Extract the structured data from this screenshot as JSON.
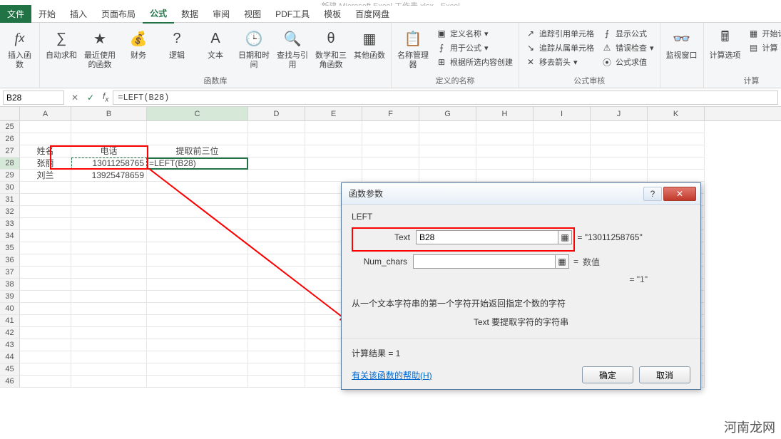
{
  "title": "新建 Microsoft Excel 工作表.xlsx - Excel",
  "tabs": {
    "file": "文件",
    "home": "开始",
    "insert": "插入",
    "layout": "页面布局",
    "formulas": "公式",
    "data": "数据",
    "review": "审阅",
    "view": "视图",
    "pdf": "PDF工具",
    "template": "模板",
    "baidu": "百度网盘"
  },
  "ribbon": {
    "g1_label": "",
    "insertFn": "插入函数",
    "autosum": "自动求和",
    "recent": "最近使用的函数",
    "financial": "财务",
    "logical": "逻辑",
    "text": "文本",
    "datetime": "日期和时间",
    "lookup": "查找与引用",
    "math": "数学和三角函数",
    "more": "其他函数",
    "glib": "函数库",
    "nameMgr": "名称管理器",
    "defName": "定义名称",
    "useFormula": "用于公式",
    "createFromSel": "根据所选内容创建",
    "gnames": "定义的名称",
    "tracePrec": "追踪引用单元格",
    "traceDep": "追踪从属单元格",
    "removeArr": "移去箭头",
    "showFormulas": "显示公式",
    "errCheck": "错误检查",
    "evalFormula": "公式求值",
    "gaudit": "公式审核",
    "watch": "监视窗口",
    "calcOpt": "计算选项",
    "calcNow": "开始计算",
    "calcSheet": "计算",
    "gcalc": "计算"
  },
  "namebox": "B28",
  "formula": "=LEFT(B28)",
  "columns": [
    "A",
    "B",
    "C",
    "D",
    "E",
    "F",
    "G",
    "H",
    "I",
    "J",
    "K"
  ],
  "rows": [
    "25",
    "26",
    "27",
    "28",
    "29",
    "30",
    "31",
    "32",
    "33",
    "34",
    "35",
    "36",
    "37",
    "38",
    "39",
    "40",
    "41",
    "42",
    "43",
    "44",
    "45",
    "46"
  ],
  "cells": {
    "A27": "姓名",
    "B27": "电话",
    "C27": "提取前三位",
    "A28": "张丽",
    "B28": "13011258765",
    "C28": "=LEFT(B28)",
    "A29": "刘兰",
    "B29": "13925478659"
  },
  "dialog": {
    "title": "函数参数",
    "fn": "LEFT",
    "argText": "Text",
    "argTextVal": "B28",
    "argTextResult": "\"13011258765\"",
    "argNum": "Num_chars",
    "argNumVal": "",
    "argNumResult": "数值",
    "evalEq": "= \"1\"",
    "desc": "从一个文本字符串的第一个字符开始返回指定个数的字符",
    "argDesc": "Text  要提取字符的字符串",
    "result": "计算结果 =  1",
    "help": "有关该函数的帮助(H)",
    "ok": "确定",
    "cancel": "取消"
  },
  "watermark": "河南龙网"
}
